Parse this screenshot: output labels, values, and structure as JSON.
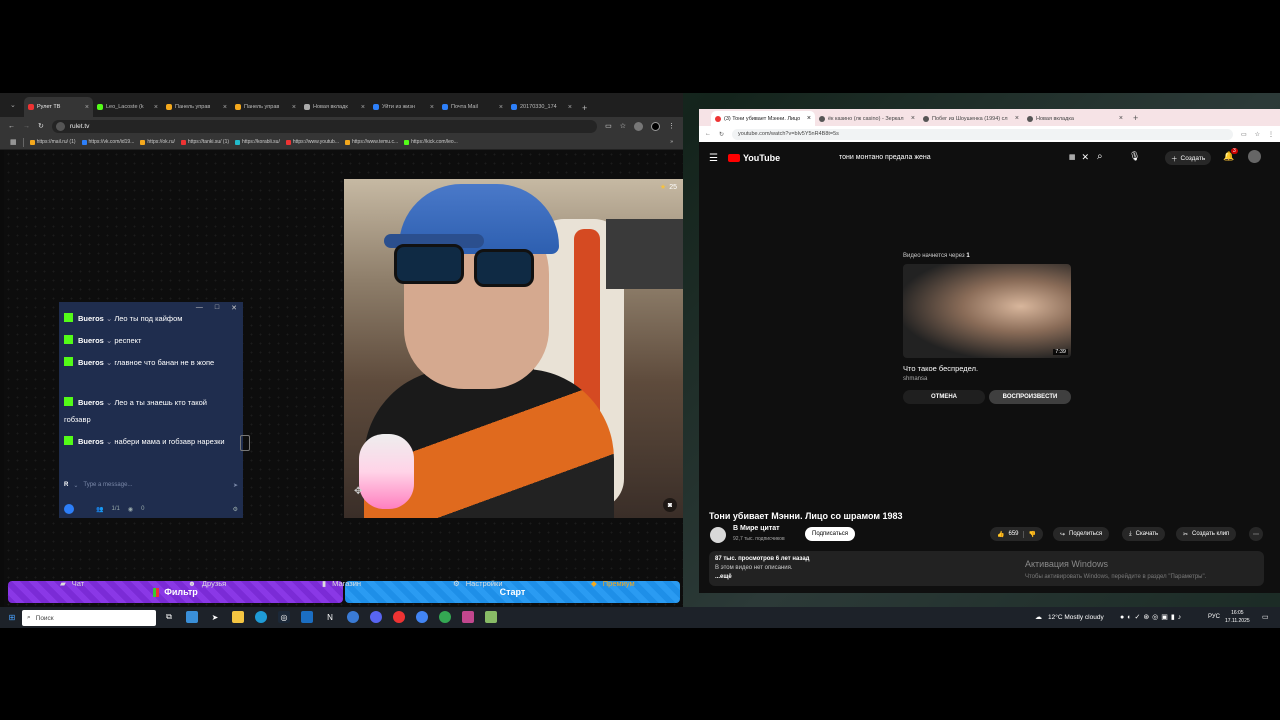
{
  "left_browser": {
    "tabs": [
      {
        "label": "Рулет ТВ",
        "color": "#e33",
        "active": true
      },
      {
        "label": "Leo_Lacoste (k",
        "color": "#53fc18"
      },
      {
        "label": "Панель управ",
        "color": "#f4a81d"
      },
      {
        "label": "Панель управ",
        "color": "#f4a81d"
      },
      {
        "label": "Новая вкладк",
        "color": "#aaa"
      },
      {
        "label": "Уйти из жизн",
        "color": "#2d7ff9"
      },
      {
        "label": "Почта Mail",
        "color": "#2d7ff9"
      },
      {
        "label": "20170330_174",
        "color": "#2d7ff9"
      }
    ],
    "url": "rulet.tv",
    "bookmarks": [
      {
        "label": "https://mail.ru/ (1)",
        "color": "#f4a81d"
      },
      {
        "label": "https://vk.com/id19...",
        "color": "#2d7ff9"
      },
      {
        "label": "https://ok.ru/",
        "color": "#f4a81d"
      },
      {
        "label": "https://tanki.su/ (1)",
        "color": "#e33"
      },
      {
        "label": "https://korabli.su/",
        "color": "#2bc"
      },
      {
        "label": "https://www.youtub...",
        "color": "#e33"
      },
      {
        "label": "https://www.temu.c...",
        "color": "#f4a81d"
      },
      {
        "label": "https://kick.com/leo...",
        "color": "#53fc18"
      }
    ],
    "video_star_count": "25",
    "chat": {
      "messages": [
        {
          "user": "Bueros",
          "text": "Лео ты под кайфом"
        },
        {
          "user": "Bueros",
          "text": "респект"
        },
        {
          "user": "Bueros",
          "text": "главное что банан не в жопе"
        },
        {
          "user": "Bueros",
          "text": "Лео а ты знаешь кто такой гобзавр"
        },
        {
          "user": "Bueros",
          "text": "набери мама и гобзавр нарезки"
        }
      ],
      "input_placeholder": "Type a message...",
      "avatar_letter": "R",
      "user_count": "1/1",
      "viewers": "0"
    },
    "filter_label": "Фильтр",
    "start_label": "Старт",
    "nav": {
      "chat": "Чат",
      "friends": "Друзья",
      "shop": "Магазин",
      "settings": "Настройки",
      "premium": "Премиум"
    }
  },
  "right_browser": {
    "tabs": [
      {
        "label": "(3) Тони убивает Мэнни. Лицо",
        "color": "#e33",
        "active": true
      },
      {
        "label": "ёк казино (лк casino) - Зеркал",
        "color": "#555"
      },
      {
        "label": "Побег из Шоушенка (1994) сл",
        "color": "#555"
      },
      {
        "label": "Новая вкладка",
        "color": "#555"
      }
    ],
    "url": "youtube.com/watch?v=bIv5Y5nR4B8t=5s",
    "yt_logo": "YouTube",
    "search_query": "тони монтано предала жена",
    "create_label": "Создать",
    "notif_count": "3",
    "next_video": {
      "countdown_prefix": "Видео начнется через",
      "countdown": "1",
      "duration": "7:39",
      "title": "Что такое беспредел.",
      "channel": "shmansa",
      "cancel_label": "ОТМЕНА",
      "play_label": "ВОСПРОИЗВЕСТИ"
    },
    "video_title": "Тони убивает Мэнни. Лицо со шрамом 1983",
    "channel_name": "В Мире цитат",
    "subscribers": "92,7 тыс. подписчиков",
    "subscribe_label": "Подписаться",
    "likes": "659",
    "share_label": "Поделиться",
    "download_label": "Скачать",
    "clip_label": "Создать клип",
    "views_line": "87 тыс. просмотров  6 лет назад",
    "description": "В этом видео нет описания.",
    "more_label": "...ещё",
    "activation_title": "Активация Windows",
    "activation_text": "Чтобы активировать Windows, перейдите в раздел \"Параметры\"."
  },
  "taskbar": {
    "search_placeholder": "Поиск",
    "weather": "12°C  Mostly cloudy",
    "lang": "РУС",
    "time": "16:05",
    "date": "17.11.2025"
  }
}
